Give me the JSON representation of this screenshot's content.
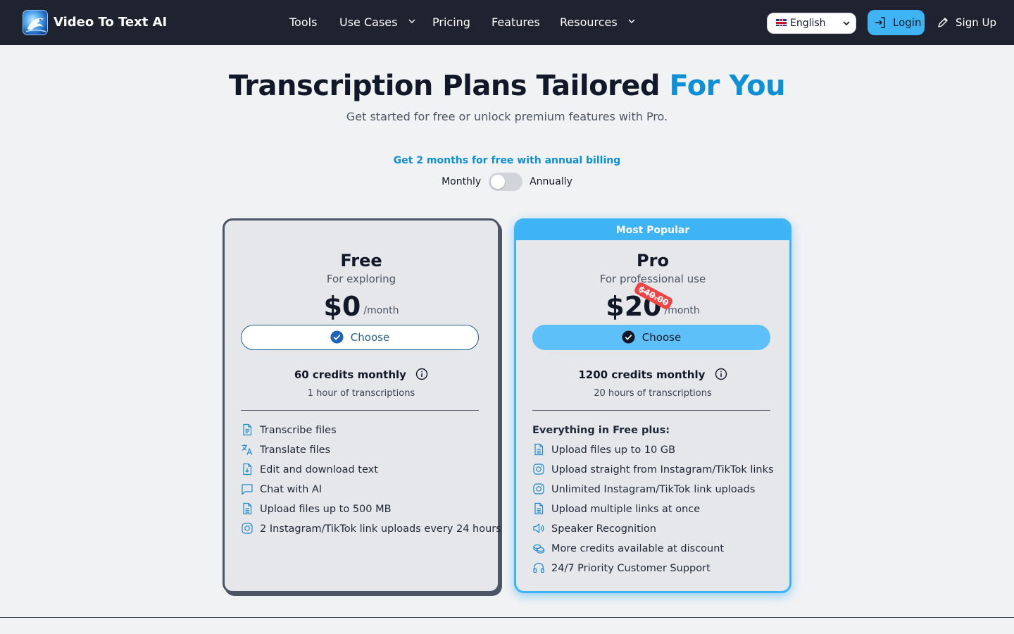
{
  "header": {
    "brand": "Video To Text AI",
    "nav": [
      {
        "label": "Tools",
        "dropdown": false
      },
      {
        "label": "Use Cases",
        "dropdown": true
      },
      {
        "label": "Pricing",
        "dropdown": false
      },
      {
        "label": "Features",
        "dropdown": false
      },
      {
        "label": "Resources",
        "dropdown": true
      }
    ],
    "language": "English",
    "login_label": "Login",
    "signup_label": "Sign Up"
  },
  "hero": {
    "title_main": "Transcription Plans Tailored",
    "title_accent": "For You",
    "subtitle": "Get started for free or unlock premium features with Pro."
  },
  "billing": {
    "promo": "Get 2 months for free with annual billing",
    "monthly_label": "Monthly",
    "annually_label": "Annually",
    "annual_selected": false
  },
  "plans": {
    "free": {
      "name": "Free",
      "description": "For exploring",
      "price": "$0",
      "period": "/month",
      "cta": "Choose",
      "credits": "60 credits monthly",
      "hours": "1 hour of transcriptions",
      "features": [
        {
          "icon": "file-text-icon",
          "label": "Transcribe files"
        },
        {
          "icon": "translate-icon",
          "label": "Translate files"
        },
        {
          "icon": "file-download-icon",
          "label": "Edit and download text"
        },
        {
          "icon": "chat-icon",
          "label": "Chat with AI"
        },
        {
          "icon": "file-upload-icon",
          "label": "Upload files up to 500 MB"
        },
        {
          "icon": "instagram-icon",
          "label": "2 Instagram/TikTok link uploads every 24 hours"
        }
      ]
    },
    "pro": {
      "badge": "Most Popular",
      "name": "Pro",
      "description": "For professional use",
      "price": "$20",
      "old_price": "$40.00",
      "period": "/month",
      "cta": "Choose",
      "credits": "1200 credits monthly",
      "hours": "20 hours of transcriptions",
      "features_heading": "Everything in Free plus:",
      "features": [
        {
          "icon": "file-upload-icon",
          "label": "Upload files up to 10 GB"
        },
        {
          "icon": "instagram-icon",
          "label": "Upload straight from Instagram/TikTok links"
        },
        {
          "icon": "instagram-icon",
          "label": "Unlimited Instagram/TikTok link uploads"
        },
        {
          "icon": "file-upload-icon",
          "label": "Upload multiple links at once"
        },
        {
          "icon": "speaker-icon",
          "label": "Speaker Recognition"
        },
        {
          "icon": "coins-icon",
          "label": "More credits available at discount"
        },
        {
          "icon": "headphones-icon",
          "label": "24/7 Priority Customer Support"
        }
      ]
    }
  },
  "colors": {
    "nav_bg": "#1f2330",
    "accent": "#0e8fd6",
    "pro_border": "#3fb4f5",
    "old_price_badge": "#ef4444"
  }
}
